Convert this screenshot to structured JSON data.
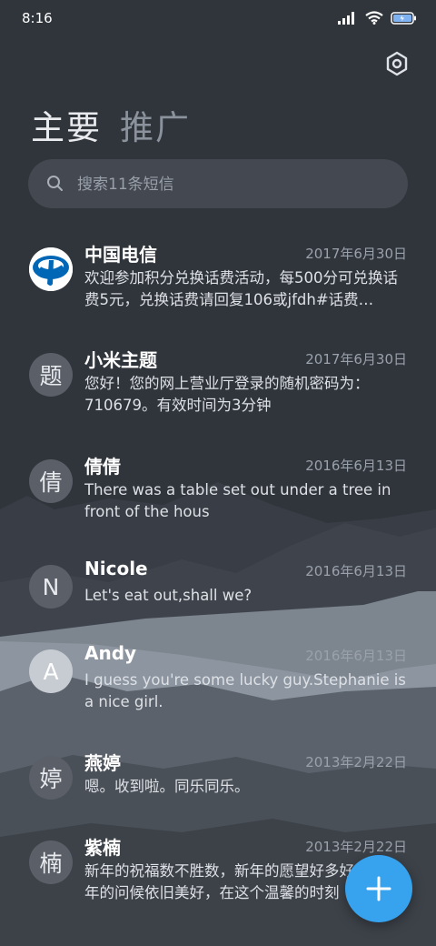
{
  "status_bar": {
    "time": "8:16"
  },
  "tabs": [
    {
      "label": "主要"
    },
    {
      "label": "推广"
    }
  ],
  "search": {
    "placeholder": "搜索11条短信"
  },
  "messages": [
    {
      "sender": "中国电信",
      "date": "2017年6月30日",
      "avatar": "telecom-logo",
      "preview": "欢迎参加积分兑换话费活动，每500分可兑换话费5元，兑换话费请回复106或jfdh#话费…"
    },
    {
      "sender": "小米主题",
      "date": "2017年6月30日",
      "avatar": "题",
      "preview": "您好！您的网上营业厅登录的随机密码为：710679。有效时间为3分钟"
    },
    {
      "sender": "倩倩",
      "date": "2016年6月13日",
      "avatar": "倩",
      "preview": "There was a table set out under a tree in front of the hous"
    },
    {
      "sender": "Nicole",
      "date": "2016年6月13日",
      "avatar": "N",
      "preview": "Let's eat out,shall we?"
    },
    {
      "sender": "Andy",
      "date": "2016年6月13日",
      "avatar": "A",
      "preview": "I guess you're some lucky guy.Stephanie is a nice girl."
    },
    {
      "sender": "燕婷",
      "date": "2013年2月22日",
      "avatar": "婷",
      "preview": "嗯。收到啦。同乐同乐。"
    },
    {
      "sender": "紫楠",
      "date": "2013年2月22日",
      "avatar": "楠",
      "preview": "新年的祝福数不胜数，新年的愿望好多好多，新年的问候依旧美好，在这个温馨的时刻"
    }
  ],
  "colors": {
    "accent": "#37a3ef",
    "background": "#2f333a"
  },
  "icons": [
    "settings-icon",
    "search-icon",
    "wifi-icon",
    "signal-icon",
    "battery-icon",
    "plus-icon"
  ]
}
